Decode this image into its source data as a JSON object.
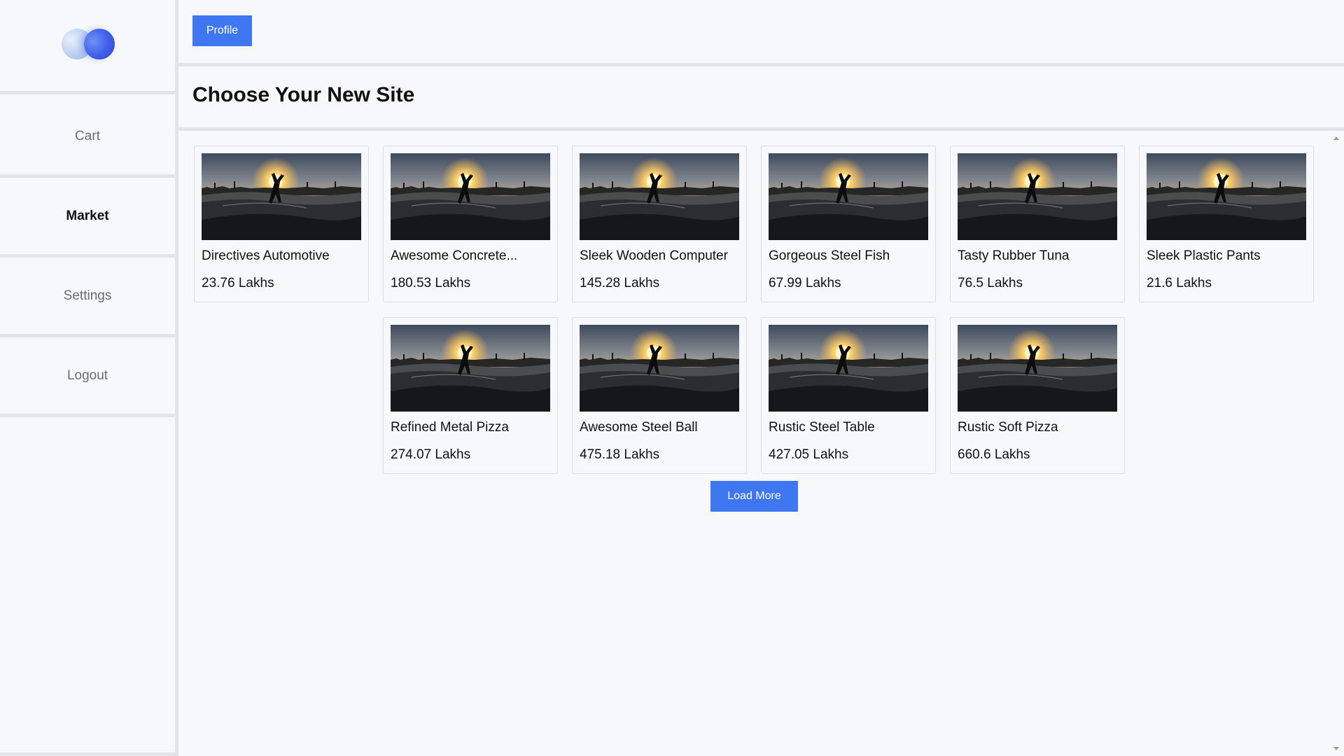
{
  "sidebar": {
    "logo": "logo-icon",
    "items": [
      {
        "label": "Cart"
      },
      {
        "label": "Market"
      },
      {
        "label": "Settings"
      },
      {
        "label": "Logout"
      }
    ]
  },
  "topbar": {
    "profile_label": "Profile"
  },
  "page": {
    "title": "Choose Your New Site"
  },
  "colors": {
    "accent": "#3f76f1",
    "divider": "#e3e4e8",
    "background": "#f7f8fc"
  },
  "sites": [
    {
      "name": "Directives Automotive",
      "price": "23.76 Lakhs"
    },
    {
      "name": "Awesome Concrete...",
      "price": "180.53 Lakhs"
    },
    {
      "name": "Sleek Wooden Computer",
      "price": "145.28 Lakhs"
    },
    {
      "name": "Gorgeous Steel Fish",
      "price": "67.99 Lakhs"
    },
    {
      "name": "Tasty Rubber Tuna",
      "price": "76.5 Lakhs"
    },
    {
      "name": "Sleek Plastic Pants",
      "price": "21.6 Lakhs"
    },
    {
      "name": "Refined Metal Pizza",
      "price": "274.07 Lakhs"
    },
    {
      "name": "Awesome Steel Ball",
      "price": "475.18 Lakhs"
    },
    {
      "name": "Rustic Steel Table",
      "price": "427.05 Lakhs"
    },
    {
      "name": "Rustic Soft Pizza",
      "price": "660.6 Lakhs"
    }
  ],
  "load_more_label": "Load More"
}
